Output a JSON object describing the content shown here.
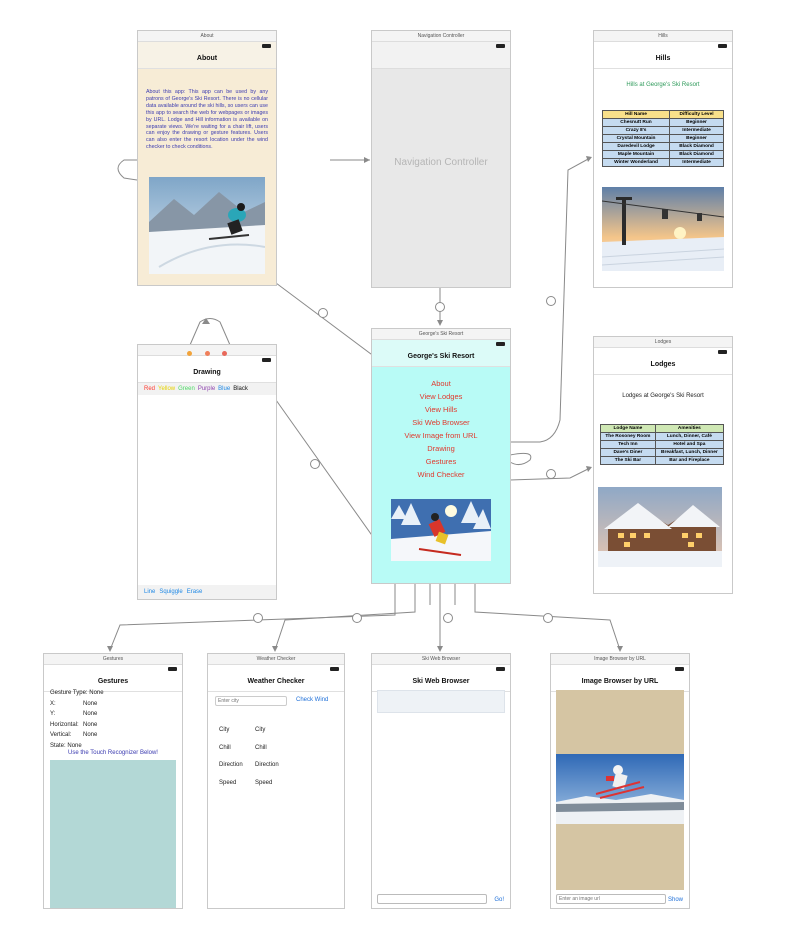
{
  "about": {
    "scene_title": "About",
    "nav_title": "About",
    "body": "About this app: This app can be used by any patrons of George's Ski Resort. There is no cellular data available around the ski hills, so users can use this app to search the web for webpages or images by URL. Lodge and Hill information is available on separate views. We're waiting for a chair lift, users can enjoy the drawing or gesture features. Users can also enter the resort location under the wind checker to check conditions."
  },
  "nav_controller": {
    "scene_title": "Navigation Controller",
    "label": "Navigation Controller"
  },
  "hills": {
    "scene_title": "Hills",
    "nav_title": "Hills",
    "subtitle": "Hills at George's Ski Resort",
    "headers": [
      "Hill Name",
      "Difficulty Level"
    ],
    "rows": [
      [
        "Chesnutt Run",
        "Beginner"
      ],
      [
        "Crazy 8's",
        "Intermediate"
      ],
      [
        "Crystal Mountain",
        "Beginner"
      ],
      [
        "Daredevil Lodge",
        "Black Diamond"
      ],
      [
        "Maple Mountain",
        "Black Diamond"
      ],
      [
        "Winter Wonderland",
        "Intermediate"
      ]
    ]
  },
  "main": {
    "scene_title": "George's Ski Resort",
    "nav_title": "George's Ski Resort",
    "menu": [
      "About",
      "View Lodges",
      "View Hills",
      "Ski Web Browser",
      "View Image from URL",
      "Drawing",
      "Gestures",
      "Wind Checker"
    ]
  },
  "drawing": {
    "nav_title": "Drawing",
    "colors": [
      {
        "label": "Red",
        "color": "#ff3b30"
      },
      {
        "label": "Yellow",
        "color": "#e6d200"
      },
      {
        "label": "Green",
        "color": "#4cd964"
      },
      {
        "label": "Purple",
        "color": "#8e44ad"
      },
      {
        "label": "Blue",
        "color": "#1e88e5"
      },
      {
        "label": "Black",
        "color": "#111111"
      }
    ],
    "tools": [
      "Line",
      "Squiggle",
      "Erase"
    ]
  },
  "lodges": {
    "scene_title": "Lodges",
    "nav_title": "Lodges",
    "subtitle": "Lodges at George's Ski Resort",
    "headers": [
      "Lodge Name",
      "Amenities"
    ],
    "rows": [
      [
        "The Rosoney Room",
        "Lunch, Dinner, Café"
      ],
      [
        "Tech Inn",
        "Hotel and Spa"
      ],
      [
        "Dave's Diner",
        "Breakfast, Lunch, Dinner"
      ],
      [
        "The Ski Bar",
        "Bar and Fireplace"
      ]
    ]
  },
  "gestures": {
    "scene_title": "Gestures",
    "nav_title": "Gestures",
    "fields": [
      {
        "label": "Gesture Type:",
        "value": "None"
      },
      {
        "label": "X:",
        "value": "None"
      },
      {
        "label": "Y:",
        "value": "None"
      },
      {
        "label": "Horizontal:",
        "value": "None"
      },
      {
        "label": "Vertical:",
        "value": "None"
      },
      {
        "label": "State:",
        "value": "None"
      }
    ],
    "hint": "Use the Touch Recognizer Below!"
  },
  "weather": {
    "scene_title": "Weather Checker",
    "nav_title": "Weather Checker",
    "input_placeholder": "Enter city",
    "button": "Check Wind",
    "rows": [
      {
        "label": "City",
        "value": "City"
      },
      {
        "label": "Chill",
        "value": "Chill"
      },
      {
        "label": "Direction",
        "value": "Direction"
      },
      {
        "label": "Speed",
        "value": "Speed"
      }
    ]
  },
  "web": {
    "scene_title": "Ski Web Browser",
    "nav_title": "Ski Web Browser",
    "button": "Go!"
  },
  "image_url": {
    "scene_title": "Image Browser by URL",
    "nav_title": "Image Browser by URL",
    "input_placeholder": "Enter an image url",
    "button": "Show"
  }
}
